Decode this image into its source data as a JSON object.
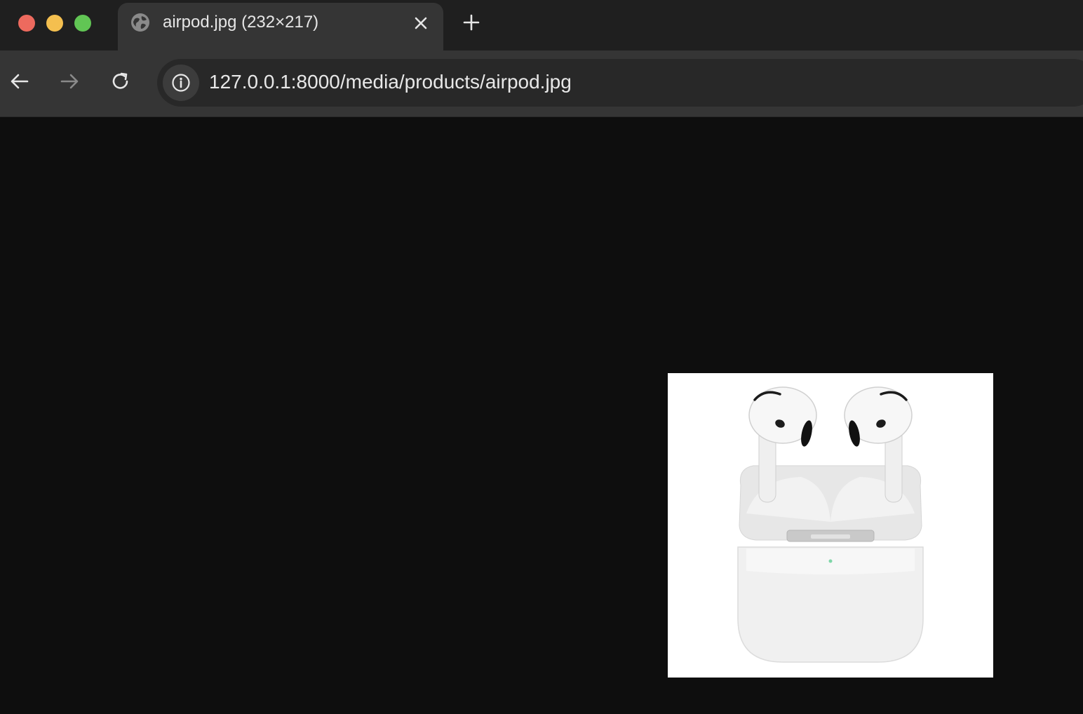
{
  "window": {
    "traffic_lights": {
      "close": "#ed6a5e",
      "minimize": "#f4bf4f",
      "maximize": "#61c554"
    }
  },
  "tab": {
    "title": "airpod.jpg (232×217)",
    "favicon": "globe-icon",
    "close_icon": "close-icon"
  },
  "new_tab_icon": "plus-icon",
  "toolbar": {
    "back_icon": "arrow-left-icon",
    "forward_icon": "arrow-right-icon",
    "reload_icon": "reload-icon",
    "site_info_icon": "info-icon",
    "url": "127.0.0.1:8000/media/products/airpod.jpg"
  },
  "content": {
    "background": "#0e0e0e",
    "image_alt": "AirPods with charging case"
  }
}
